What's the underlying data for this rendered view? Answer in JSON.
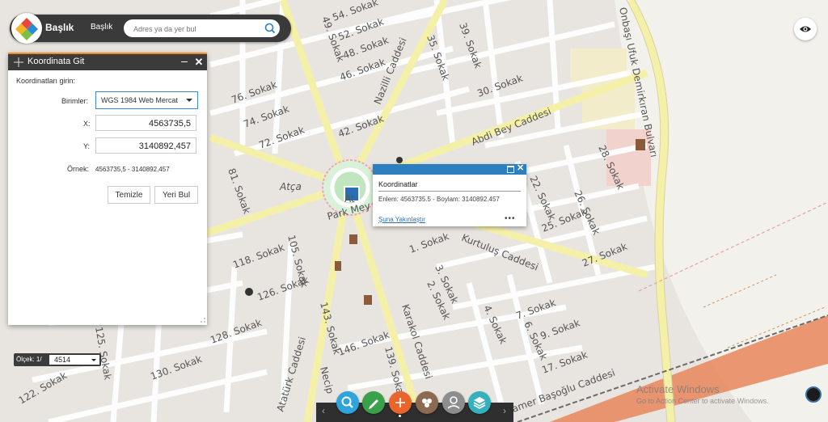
{
  "header": {
    "app_title": "Başlık",
    "tab_label": "Başlık",
    "search_placeholder": "Adres ya da yer bul"
  },
  "panel": {
    "title": "Koordinata Git",
    "prompt": "Koordinatları girin:",
    "units_label": "Birimler:",
    "units_value": "WGS 1984 Web Mercat",
    "x_label": "X:",
    "x_value": "4563735,5",
    "y_label": "Y:",
    "y_value": "3140892,457",
    "example_label": "Örnek:",
    "example_value": "4563735,5 - 3140892,457",
    "clear_button": "Temizle",
    "find_button": "Yeri Bul"
  },
  "popup": {
    "title": "Koordinatlar",
    "text": "Enlem: 4563735.5 - Boylam: 3140892.457",
    "zoom_link": "Şuna Yakınlaştır",
    "more": "•••"
  },
  "scale": {
    "label": "Ölçek: 1/",
    "value": "4514"
  },
  "map_labels": {
    "s54": "54. Sokak",
    "s52": "52. Sokak",
    "s48": "48. Sokak",
    "s46": "46. Sokak",
    "s76": "76. Sokak",
    "s74": "74. Sokak",
    "s72": "72. Sokak",
    "s42": "42. Sokak",
    "s30": "30. Sokak",
    "s28": "28. Sokak",
    "s22": "22. Sokak",
    "s26": "26. Sokak",
    "s25": "25. Sokak",
    "s27": "27. Sokak",
    "s118": "118. Sokak",
    "s126": "126. Sokak",
    "s128": "128. Sokak",
    "s130": "130. Sokak",
    "s122": "122. Sokak",
    "s146": "146. Sokak",
    "s17": "17. Sokak",
    "s9": "9. Sokak",
    "s7": "7. Sokak",
    "s1": "1. Sokak",
    "s3": "3. Sokak",
    "s2": "2. Sokak",
    "s4": "4. Sokak",
    "s6": "6. Sokak",
    "s81": "81. Sokak",
    "s105": "105. Sokak",
    "s143": "143. Sokak",
    "s139": "139. Sokak",
    "s125": "125. Sokak",
    "s35": "35. Sokak",
    "s39": "39. Sokak",
    "s49": "49. Sokak",
    "nazilli": "Nazilli Caddesi",
    "abdibey": "Abdi Bey Caddesi",
    "kurtulus": "Kurtuluş Caddesi",
    "karakol": "Karakol Caddesi",
    "ataturk": "Atatürk Caddesi",
    "necip": "Necip",
    "tamer": "Tamer Başoğlu Caddesi",
    "onbasi": "Onbaşı Ufuk Demirkıran Bulvarı",
    "atca": "Atça",
    "atca_short": "At",
    "park": "Park Mey"
  },
  "watermark": {
    "line1": "Activate Windows",
    "line2": "Go to Action Center to activate Windows."
  }
}
